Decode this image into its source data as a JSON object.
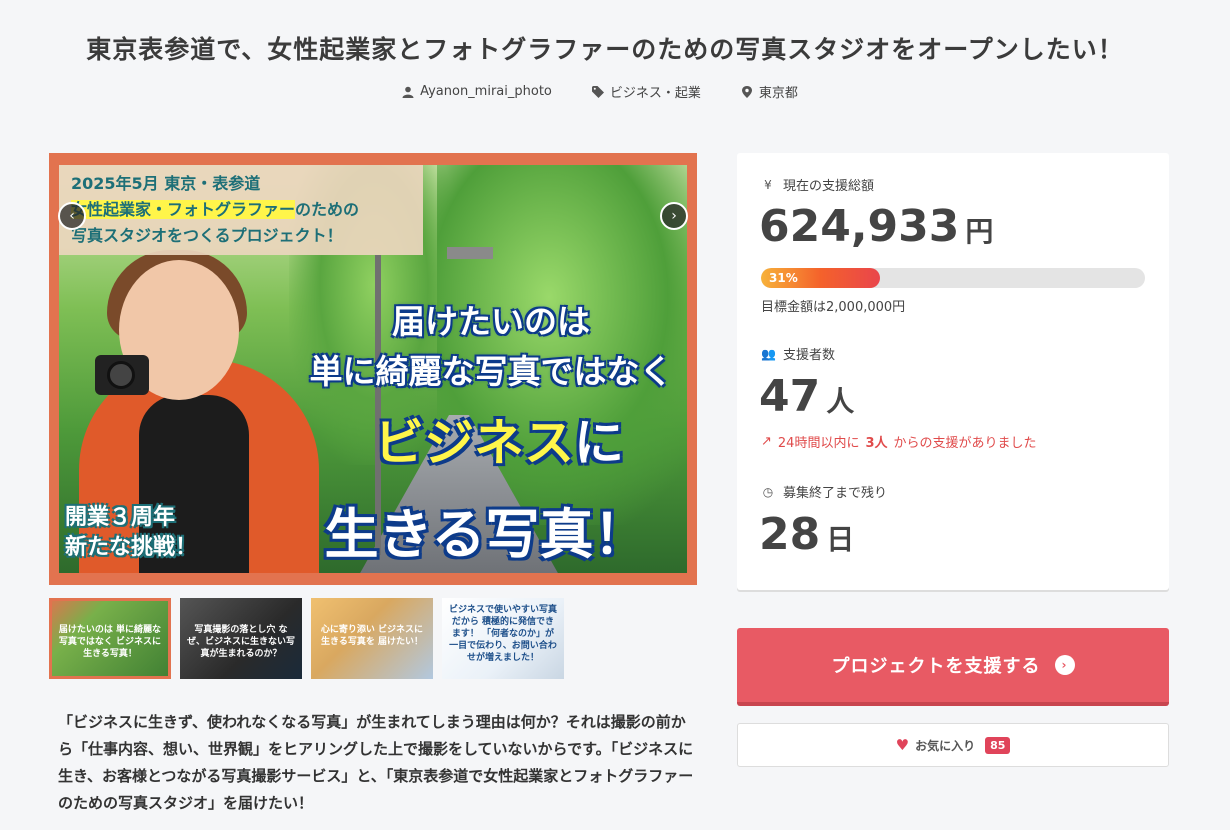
{
  "project": {
    "title": "東京表参道で、女性起業家とフォトグラファーのための写真スタジオをオープンしたい！",
    "owner": "Ayanon_mirai_photo",
    "category": "ビジネス・起業",
    "location": "東京都"
  },
  "hero": {
    "tag_line1": "2025年5月 東京・表参道",
    "tag_line2_hl": "女性起業家・フォトグラファー",
    "tag_line2_rest": "のための",
    "tag_line3": "写真スタジオをつくるプロジェクト！",
    "headline1": "届けたいのは",
    "headline2": "単に綺麗な写真ではなく",
    "headline3_yellow": "ビジネス",
    "headline3_white": "に",
    "headline4": "生きる写真！",
    "anniv1": "開業３周年",
    "anniv2": "新たな挑戦！"
  },
  "thumbs": [
    {
      "caption": "届けたいのは 単に綺麗な写真ではなく ビジネスに生きる写真！"
    },
    {
      "caption": "写真撮影の落とし穴 なぜ、ビジネスに生きない写真が生まれるのか？"
    },
    {
      "caption": "心に寄り添い ビジネスに生きる写真を 届けたい！"
    },
    {
      "caption": "ビジネスで使いやすい写真だから 積極的に発信できます！ 「何者なのか」が一目で伝わり、お問い合わせが増えました！"
    }
  ],
  "description": "「ビジネスに生きず、使われなくなる写真」が生まれてしまう理由は何か？それは撮影の前から「仕事内容、想い、世界観」をヒアリングした上で撮影をしていないからです。「ビジネスに生き、お客様とつながる写真撮影サービス」と、「東京表参道で女性起業家とフォトグラファーのための写真スタジオ」を届けたい！",
  "stats": {
    "amount_label": "現在の支援総額",
    "amount": "624,933",
    "amount_unit": "円",
    "progress_percent": 31,
    "progress_label": "31%",
    "target": "目標金額は2,000,000円",
    "supporters_label": "支援者数",
    "supporters": "47",
    "supporters_unit": "人",
    "recent_prefix": "24時間以内に",
    "recent_count": "3人",
    "recent_suffix": "からの支援がありました",
    "remaining_label": "募集終了まで残り",
    "remaining": "28",
    "remaining_unit": "日"
  },
  "actions": {
    "support_label": "プロジェクトを支援する",
    "favorite_label": "お気に入り",
    "favorite_count": "85"
  },
  "colors": {
    "primary": "#e85a64",
    "accent_orange": "#e2734f",
    "alert_red": "#e04b4b"
  }
}
